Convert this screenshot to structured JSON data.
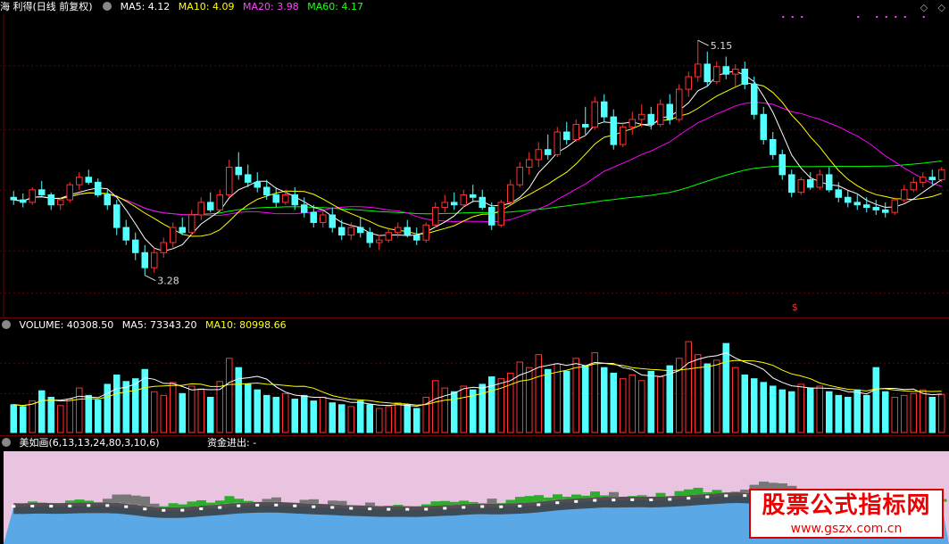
{
  "price_panel": {
    "title": "海 利得(日线 前复权)",
    "ma5": "MA5: 4.12",
    "ma10": "MA10: 4.09",
    "ma20": "MA20: 3.98",
    "ma60": "MA60: 4.17",
    "high_label": "5.15",
    "low_label": "3.28",
    "signal_mark": "$",
    "colors": {
      "up": "#ff3232",
      "down": "#54ffff",
      "ma5": "#ffffff",
      "ma10": "#ffff00",
      "ma20": "#ff00ff",
      "ma60": "#00ff00",
      "grid": "#6b0000"
    }
  },
  "volume_panel": {
    "volume": "VOLUME: 40308.50",
    "ma5": "MA5: 73343.20",
    "ma10": "MA10: 80998.66"
  },
  "indicator_panel": {
    "title": "美如画(6,13,13,24,80,3,10,6)",
    "fund_flow": "资金进出: -",
    "colors": {
      "bg": "#e8c4e0",
      "blue": "#5aa8e6",
      "green": "#2cae2c",
      "dark": "#3a3a3a"
    }
  },
  "controls": [
    "◇",
    "◇"
  ],
  "watermark": {
    "title": "股票公式指标网",
    "url": "www.gszx.com.cn"
  },
  "chart_data": {
    "type": "candlestick",
    "title": "海 利得(日线 前复权)",
    "price_axis": {
      "high_marked": 5.15,
      "low_marked": 3.28
    },
    "moving_averages": {
      "MA5": 4.12,
      "MA10": 4.09,
      "MA20": 3.98,
      "MA60": 4.17
    },
    "candles_ohlc": [
      [
        3.9,
        3.95,
        3.84,
        3.88
      ],
      [
        3.88,
        3.93,
        3.82,
        3.86
      ],
      [
        3.86,
        3.98,
        3.84,
        3.96
      ],
      [
        3.96,
        4.03,
        3.9,
        3.92
      ],
      [
        3.92,
        3.94,
        3.8,
        3.84
      ],
      [
        3.84,
        3.9,
        3.8,
        3.88
      ],
      [
        3.88,
        4.02,
        3.86,
        4.0
      ],
      [
        4.0,
        4.1,
        3.96,
        4.06
      ],
      [
        4.06,
        4.12,
        4.0,
        4.02
      ],
      [
        4.02,
        4.05,
        3.9,
        3.92
      ],
      [
        3.92,
        3.96,
        3.8,
        3.84
      ],
      [
        3.84,
        3.88,
        3.6,
        3.66
      ],
      [
        3.66,
        3.72,
        3.52,
        3.56
      ],
      [
        3.56,
        3.62,
        3.4,
        3.46
      ],
      [
        3.46,
        3.52,
        3.28,
        3.34
      ],
      [
        3.34,
        3.5,
        3.3,
        3.46
      ],
      [
        3.46,
        3.58,
        3.42,
        3.54
      ],
      [
        3.54,
        3.7,
        3.5,
        3.66
      ],
      [
        3.66,
        3.74,
        3.6,
        3.62
      ],
      [
        3.62,
        3.8,
        3.6,
        3.76
      ],
      [
        3.76,
        3.9,
        3.72,
        3.86
      ],
      [
        3.86,
        3.94,
        3.78,
        3.8
      ],
      [
        3.8,
        3.96,
        3.78,
        3.92
      ],
      [
        3.92,
        4.2,
        3.9,
        4.14
      ],
      [
        4.14,
        4.26,
        4.04,
        4.08
      ],
      [
        4.08,
        4.16,
        3.98,
        4.02
      ],
      [
        4.02,
        4.1,
        3.94,
        3.98
      ],
      [
        3.98,
        4.04,
        3.88,
        3.92
      ],
      [
        3.92,
        3.98,
        3.82,
        3.86
      ],
      [
        3.86,
        3.96,
        3.84,
        3.92
      ],
      [
        3.92,
        3.98,
        3.8,
        3.84
      ],
      [
        3.84,
        3.9,
        3.74,
        3.78
      ],
      [
        3.78,
        3.84,
        3.66,
        3.7
      ],
      [
        3.7,
        3.8,
        3.66,
        3.76
      ],
      [
        3.76,
        3.82,
        3.62,
        3.66
      ],
      [
        3.66,
        3.72,
        3.56,
        3.6
      ],
      [
        3.6,
        3.7,
        3.56,
        3.66
      ],
      [
        3.66,
        3.74,
        3.58,
        3.62
      ],
      [
        3.62,
        3.66,
        3.5,
        3.54
      ],
      [
        3.54,
        3.6,
        3.48,
        3.56
      ],
      [
        3.56,
        3.66,
        3.54,
        3.62
      ],
      [
        3.62,
        3.7,
        3.58,
        3.66
      ],
      [
        3.66,
        3.72,
        3.58,
        3.6
      ],
      [
        3.6,
        3.66,
        3.52,
        3.56
      ],
      [
        3.56,
        3.7,
        3.54,
        3.68
      ],
      [
        3.68,
        3.86,
        3.66,
        3.82
      ],
      [
        3.82,
        3.92,
        3.78,
        3.86
      ],
      [
        3.86,
        3.94,
        3.8,
        3.84
      ],
      [
        3.84,
        3.96,
        3.82,
        3.92
      ],
      [
        3.92,
        4.0,
        3.86,
        3.9
      ],
      [
        3.9,
        3.96,
        3.8,
        3.82
      ],
      [
        3.82,
        3.86,
        3.64,
        3.68
      ],
      [
        3.68,
        3.88,
        3.66,
        3.86
      ],
      [
        3.86,
        4.04,
        3.84,
        4.0
      ],
      [
        4.0,
        4.18,
        3.98,
        4.14
      ],
      [
        4.14,
        4.26,
        4.08,
        4.2
      ],
      [
        4.2,
        4.34,
        4.14,
        4.28
      ],
      [
        4.28,
        4.4,
        4.2,
        4.24
      ],
      [
        4.24,
        4.46,
        4.22,
        4.42
      ],
      [
        4.42,
        4.5,
        4.32,
        4.36
      ],
      [
        4.36,
        4.52,
        4.34,
        4.48
      ],
      [
        4.48,
        4.62,
        4.4,
        4.46
      ],
      [
        4.46,
        4.7,
        4.44,
        4.66
      ],
      [
        4.66,
        4.72,
        4.5,
        4.54
      ],
      [
        4.54,
        4.6,
        4.28,
        4.32
      ],
      [
        4.32,
        4.5,
        4.3,
        4.46
      ],
      [
        4.46,
        4.58,
        4.4,
        4.52
      ],
      [
        4.52,
        4.64,
        4.46,
        4.56
      ],
      [
        4.56,
        4.62,
        4.44,
        4.48
      ],
      [
        4.48,
        4.68,
        4.46,
        4.64
      ],
      [
        4.64,
        4.72,
        4.48,
        4.52
      ],
      [
        4.52,
        4.8,
        4.5,
        4.76
      ],
      [
        4.76,
        4.9,
        4.7,
        4.86
      ],
      [
        4.86,
        5.15,
        4.82,
        4.96
      ],
      [
        4.96,
        5.06,
        4.78,
        4.82
      ],
      [
        4.82,
        4.98,
        4.8,
        4.94
      ],
      [
        4.94,
        5.02,
        4.84,
        4.88
      ],
      [
        4.88,
        4.96,
        4.78,
        4.92
      ],
      [
        4.92,
        4.98,
        4.76,
        4.8
      ],
      [
        4.8,
        4.86,
        4.52,
        4.56
      ],
      [
        4.56,
        4.62,
        4.32,
        4.36
      ],
      [
        4.36,
        4.42,
        4.2,
        4.24
      ],
      [
        4.24,
        4.28,
        4.04,
        4.08
      ],
      [
        4.08,
        4.12,
        3.9,
        3.94
      ],
      [
        3.94,
        4.06,
        3.92,
        4.04
      ],
      [
        4.04,
        4.1,
        3.96,
        3.98
      ],
      [
        3.98,
        4.12,
        3.96,
        4.08
      ],
      [
        4.08,
        4.14,
        3.94,
        3.96
      ],
      [
        3.96,
        4.02,
        3.86,
        3.9
      ],
      [
        3.9,
        3.96,
        3.82,
        3.86
      ],
      [
        3.86,
        3.92,
        3.8,
        3.84
      ],
      [
        3.84,
        3.9,
        3.78,
        3.82
      ],
      [
        3.82,
        3.88,
        3.76,
        3.8
      ],
      [
        3.8,
        3.86,
        3.74,
        3.78
      ],
      [
        3.78,
        3.9,
        3.76,
        3.88
      ],
      [
        3.88,
        4.0,
        3.86,
        3.96
      ],
      [
        3.96,
        4.06,
        3.94,
        4.02
      ],
      [
        4.02,
        4.1,
        3.98,
        4.06
      ],
      [
        4.06,
        4.12,
        4.0,
        4.04
      ],
      [
        4.04,
        4.14,
        4.02,
        4.12
      ]
    ],
    "volume": [
      30,
      28,
      34,
      45,
      38,
      29,
      36,
      48,
      40,
      35,
      52,
      62,
      55,
      58,
      68,
      44,
      40,
      54,
      42,
      50,
      47,
      38,
      55,
      80,
      70,
      52,
      46,
      40,
      38,
      42,
      36,
      40,
      34,
      38,
      32,
      30,
      28,
      34,
      30,
      26,
      28,
      32,
      30,
      26,
      38,
      56,
      48,
      44,
      50,
      46,
      52,
      60,
      58,
      64,
      76,
      70,
      84,
      68,
      74,
      66,
      80,
      72,
      86,
      70,
      64,
      58,
      62,
      56,
      66,
      60,
      72,
      80,
      98,
      84,
      74,
      78,
      96,
      70,
      62,
      58,
      54,
      50,
      46,
      44,
      52,
      48,
      50,
      44,
      40,
      38,
      46,
      40,
      70,
      44,
      38,
      40,
      42,
      46,
      38,
      41
    ],
    "volume_ma5": 73343.2,
    "volume_ma10": 80998.66,
    "volume_latest": 40308.5
  }
}
